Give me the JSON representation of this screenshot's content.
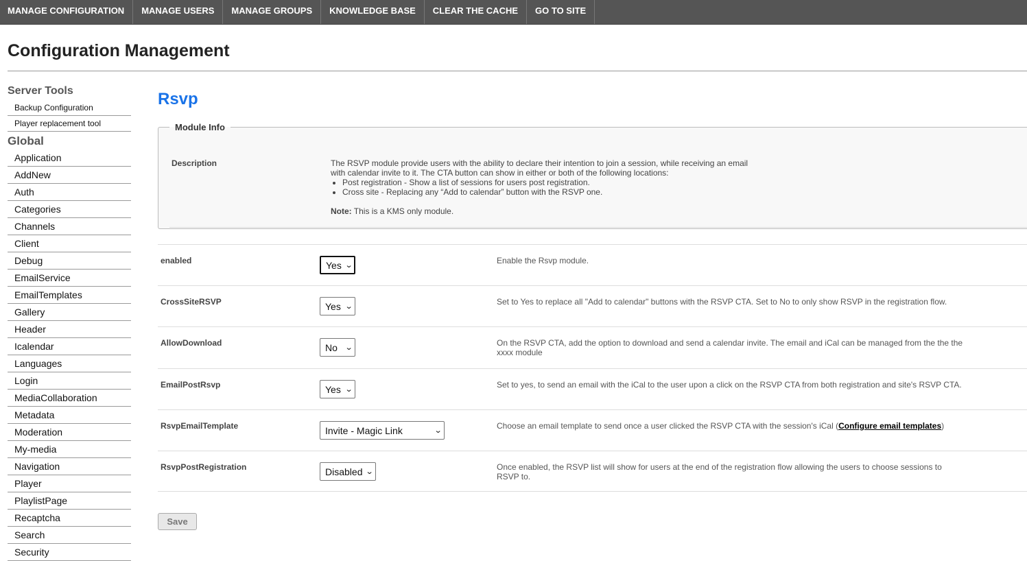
{
  "topnav": [
    "MANAGE CONFIGURATION",
    "MANAGE USERS",
    "MANAGE GROUPS",
    "KNOWLEDGE BASE",
    "CLEAR THE CACHE",
    "GO TO SITE"
  ],
  "page_title": "Configuration Management",
  "sidebar": {
    "server_tools_heading": "Server Tools",
    "server_tools": [
      "Backup Configuration",
      "Player replacement tool"
    ],
    "global_heading": "Global",
    "global": [
      "Application",
      "AddNew",
      "Auth",
      "Categories",
      "Channels",
      "Client",
      "Debug",
      "EmailService",
      "EmailTemplates",
      "Gallery",
      "Header",
      "Icalendar",
      "Languages",
      "Login",
      "MediaCollaboration",
      "Metadata",
      "Moderation",
      "My-media",
      "Navigation",
      "Player",
      "PlaylistPage",
      "Recaptcha",
      "Search",
      "Security"
    ]
  },
  "module": {
    "title": "Rsvp",
    "info_legend": "Module Info",
    "description_label": "Description",
    "description_text": "The RSVP module provide users with the ability to declare their intention to join a session, while receiving an email with calendar invite to it. The CTA button can show in either or both of the following locations:",
    "description_items": [
      "Post registration - Show a list of sessions for users post registration.",
      "Cross site - Replacing any “Add to calendar” button with the RSVP one."
    ],
    "note_label": "Note:",
    "note_text": " This is a KMS only module."
  },
  "settings": [
    {
      "label": "enabled",
      "value": "Yes",
      "width": 52,
      "help": "Enable the Rsvp module."
    },
    {
      "label": "CrossSiteRSVP",
      "value": "Yes",
      "width": 52,
      "help": "Set to Yes to replace all \"Add to calendar\" buttons with the RSVP CTA. Set to No to only show RSVP in the registration flow."
    },
    {
      "label": "AllowDownload",
      "value": "No",
      "width": 52,
      "help": "On the RSVP CTA, add the option to download and send a calendar invite. The email and iCal can be managed from the the the xxxx module"
    },
    {
      "label": "EmailPostRsvp",
      "value": "Yes",
      "width": 52,
      "help": "Set to yes, to send an email with the iCal to the user upon a click on the RSVP CTA from both registration and site's RSVP CTA."
    },
    {
      "label": "RsvpEmailTemplate",
      "value": "Invite - Magic Link",
      "width": 182,
      "help": "Choose an email template to send once a user clicked the RSVP CTA with the session's iCal (",
      "help_link": "Configure email templates",
      "help_suffix": ")"
    },
    {
      "label": "RsvpPostRegistration",
      "value": "Disabled",
      "width": 82,
      "help": "Once enabled, the RSVP list will show for users at the end of the registration flow allowing the users to choose sessions to RSVP to."
    }
  ],
  "save_label": "Save"
}
